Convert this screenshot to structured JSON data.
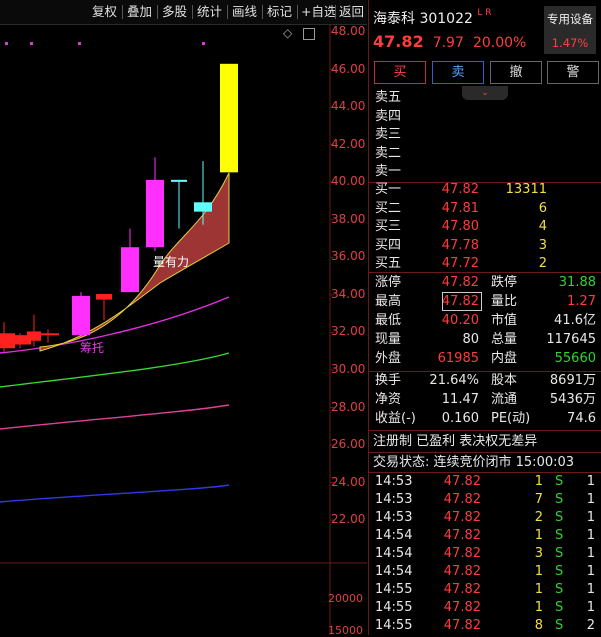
{
  "toolbar": {
    "items": [
      "复权",
      "叠加",
      "多股",
      "统计",
      "画线",
      "标记",
      "+自选",
      "返回"
    ]
  },
  "chart": {
    "y_ticks": [
      "48.00",
      "46.00",
      "44.00",
      "42.00",
      "40.00",
      "38.00",
      "36.00",
      "34.00",
      "32.00",
      "30.00",
      "28.00",
      "26.00",
      "24.00",
      "22.00"
    ],
    "vol_ticks": [
      "20000",
      "15000"
    ],
    "annotation_1": "量有力",
    "annotation_2": "筹托",
    "diamond": "◇"
  },
  "chart_data": {
    "type": "candlestick",
    "y_range": [
      21.5,
      49.5
    ],
    "candles": [
      {
        "o": 33.4,
        "c": 32.6,
        "h": 34.0,
        "l": 32.4,
        "color": "red"
      },
      {
        "o": 32.8,
        "c": 33.3,
        "h": 33.4,
        "l": 32.6,
        "color": "red"
      },
      {
        "o": 33.0,
        "c": 33.5,
        "h": 34.4,
        "l": 32.7,
        "color": "red"
      },
      {
        "o": 33.4,
        "c": 33.3,
        "h": 33.6,
        "l": 32.9,
        "color": "red"
      },
      {
        "o": 33.3,
        "c": 35.4,
        "h": 35.6,
        "l": 33.2,
        "color": "magenta"
      },
      {
        "o": 35.2,
        "c": 35.5,
        "h": 35.5,
        "l": 34.1,
        "color": "red"
      },
      {
        "o": 35.6,
        "c": 38.0,
        "h": 39.0,
        "l": 35.6,
        "color": "magenta"
      },
      {
        "o": 38.0,
        "c": 41.6,
        "h": 42.8,
        "l": 37.8,
        "color": "magenta"
      },
      {
        "o": 41.6,
        "c": 41.5,
        "h": 41.6,
        "l": 39.0,
        "color": "cyan"
      },
      {
        "o": 40.4,
        "c": 39.9,
        "h": 42.6,
        "l": 39.2,
        "color": "cyan"
      },
      {
        "o": 42.0,
        "c": 47.8,
        "h": 47.8,
        "l": 42.0,
        "color": "yellow"
      }
    ]
  },
  "header": {
    "name": "海泰科",
    "code": "301022",
    "tags": "L R",
    "device_btn": "专用设备",
    "device_pct": "1.47%",
    "price": "47.82",
    "change": "7.97",
    "pct": "20.00%"
  },
  "actions": [
    "买",
    "卖",
    "撤",
    "警"
  ],
  "sell": [
    {
      "label": "卖五",
      "price": "",
      "vol": ""
    },
    {
      "label": "卖四",
      "price": "",
      "vol": ""
    },
    {
      "label": "卖三",
      "price": "",
      "vol": ""
    },
    {
      "label": "卖二",
      "price": "",
      "vol": ""
    },
    {
      "label": "卖一",
      "price": "",
      "vol": ""
    }
  ],
  "buy": [
    {
      "label": "买一",
      "price": "47.82",
      "vol": "13311"
    },
    {
      "label": "买二",
      "price": "47.81",
      "vol": "6"
    },
    {
      "label": "买三",
      "price": "47.80",
      "vol": "4"
    },
    {
      "label": "买四",
      "price": "47.78",
      "vol": "3"
    },
    {
      "label": "买五",
      "price": "47.72",
      "vol": "2"
    }
  ],
  "stats": [
    {
      "l1": "涨停",
      "v1": "47.82",
      "c1": "red",
      "l2": "跌停",
      "v2": "31.88",
      "c2": "green"
    },
    {
      "l1": "最高",
      "v1": "47.82",
      "c1": "red",
      "l2": "量比",
      "v2": "1.27",
      "c2": "red"
    },
    {
      "l1": "最低",
      "v1": "40.20",
      "c1": "red",
      "l2": "市值",
      "v2": "41.6亿",
      "c2": "white"
    },
    {
      "l1": "现量",
      "v1": "80",
      "c1": "white",
      "l2": "总量",
      "v2": "117645",
      "c2": "white"
    },
    {
      "l1": "外盘",
      "v1": "61985",
      "c1": "red",
      "l2": "内盘",
      "v2": "55660",
      "c2": "green"
    }
  ],
  "stats2": [
    {
      "l1": "换手",
      "v1": "21.64%",
      "l2": "股本",
      "v2": "8691万"
    },
    {
      "l1": "净资",
      "v1": "11.47",
      "l2": "流通",
      "v2": "5436万"
    },
    {
      "l1": "收益(-)",
      "v1": "0.160",
      "l2": "PE(动)",
      "v2": "74.6"
    }
  ],
  "notice": "注册制 已盈利 表决权无差异",
  "trade_status": "交易状态: 连续竞价闭市 15:00:03",
  "ticks": [
    {
      "t": "14:53",
      "p": "47.82",
      "v": "1",
      "s": "S",
      "n": "1"
    },
    {
      "t": "14:53",
      "p": "47.82",
      "v": "7",
      "s": "S",
      "n": "1"
    },
    {
      "t": "14:53",
      "p": "47.82",
      "v": "2",
      "s": "S",
      "n": "1"
    },
    {
      "t": "14:54",
      "p": "47.82",
      "v": "1",
      "s": "S",
      "n": "1"
    },
    {
      "t": "14:54",
      "p": "47.82",
      "v": "3",
      "s": "S",
      "n": "1"
    },
    {
      "t": "14:54",
      "p": "47.82",
      "v": "1",
      "s": "S",
      "n": "1"
    },
    {
      "t": "14:55",
      "p": "47.82",
      "v": "1",
      "s": "S",
      "n": "1"
    },
    {
      "t": "14:55",
      "p": "47.82",
      "v": "1",
      "s": "S",
      "n": "1"
    },
    {
      "t": "14:55",
      "p": "47.82",
      "v": "8",
      "s": "S",
      "n": "2"
    }
  ]
}
